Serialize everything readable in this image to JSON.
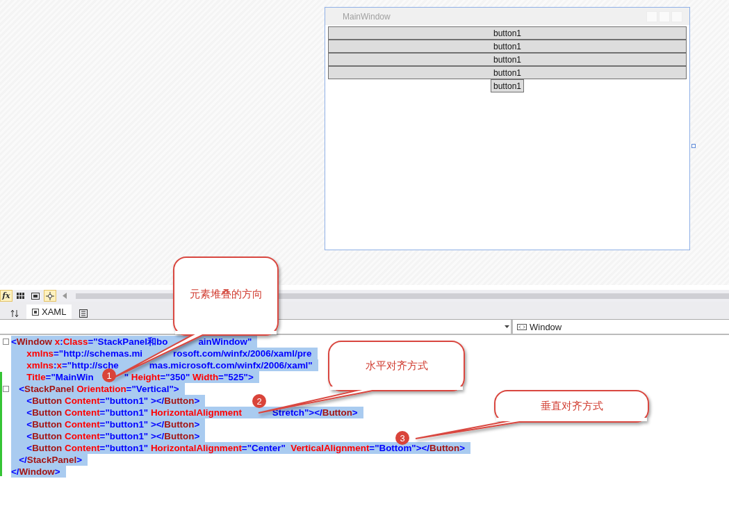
{
  "designer": {
    "window_title": "MainWindow",
    "buttons": [
      {
        "label": "button1",
        "kind": "stretch"
      },
      {
        "label": "button1",
        "kind": "stretch"
      },
      {
        "label": "button1",
        "kind": "stretch"
      },
      {
        "label": "button1",
        "kind": "stretch"
      },
      {
        "label": "button1",
        "kind": "center"
      }
    ]
  },
  "toolbar": {
    "fx": "fx",
    "tab": {
      "label": "XAML",
      "selected": true
    }
  },
  "breadcrumb": {
    "right": "Window"
  },
  "code": [
    {
      "selected": true,
      "segments": [
        {
          "kind": "bracket",
          "text": "<"
        },
        {
          "kind": "name",
          "text": "Window"
        },
        {
          "kind": "attr",
          "text": " x"
        },
        {
          "kind": "bracket",
          "text": ":"
        },
        {
          "kind": "attr",
          "text": "Class"
        },
        {
          "kind": "value",
          "text": "=\"StackPanel和bo"
        },
        {
          "kind": "gap"
        },
        {
          "kind": "value",
          "text": "ainWindow\""
        }
      ]
    },
    {
      "selected": true,
      "segments": [
        {
          "kind": "attr",
          "text": "      xmlns"
        },
        {
          "kind": "value",
          "text": "=\"http://schemas.mi"
        },
        {
          "kind": "gap"
        },
        {
          "kind": "value",
          "text": "rosoft.com/winfx/2006/xaml/pre"
        }
      ]
    },
    {
      "selected": true,
      "segments": [
        {
          "kind": "attr",
          "text": "      xmlns"
        },
        {
          "kind": "bracket",
          "text": ":"
        },
        {
          "kind": "attr",
          "text": "x"
        },
        {
          "kind": "value",
          "text": "=\"http://sche"
        },
        {
          "kind": "gap"
        },
        {
          "kind": "value",
          "text": "mas.microsoft.com/winfx/2006/xaml\""
        }
      ]
    },
    {
      "selected": true,
      "segments": [
        {
          "kind": "attr",
          "text": "      Title"
        },
        {
          "kind": "value",
          "text": "=\"MainWin"
        },
        {
          "kind": "gap"
        },
        {
          "kind": "value",
          "text": "\" "
        },
        {
          "kind": "attr",
          "text": "Height"
        },
        {
          "kind": "value",
          "text": "=\"350\" "
        },
        {
          "kind": "attr",
          "text": "Width"
        },
        {
          "kind": "value",
          "text": "=\"525\">"
        }
      ]
    },
    {
      "selected": true,
      "segments": [
        {
          "kind": "bracket",
          "text": "   <"
        },
        {
          "kind": "name",
          "text": "StackPanel"
        },
        {
          "kind": "attr",
          "text": " Orientation"
        },
        {
          "kind": "value",
          "text": "=\"Vertical\">"
        }
      ]
    },
    {
      "selected": true,
      "segments": [
        {
          "kind": "bracket",
          "text": "      <"
        },
        {
          "kind": "name",
          "text": "Button"
        },
        {
          "kind": "attr",
          "text": " Content"
        },
        {
          "kind": "value",
          "text": "=\"button1\" ></"
        },
        {
          "kind": "name",
          "text": "Button"
        },
        {
          "kind": "bracket",
          "text": ">"
        }
      ]
    },
    {
      "selected": true,
      "segments": [
        {
          "kind": "bracket",
          "text": "      <"
        },
        {
          "kind": "name",
          "text": "Button"
        },
        {
          "kind": "attr",
          "text": " Content"
        },
        {
          "kind": "value",
          "text": "=\"button1\" "
        },
        {
          "kind": "attr",
          "text": "HorizontalAlignment"
        },
        {
          "kind": "gap"
        },
        {
          "kind": "value",
          "text": "Stretch\"></"
        },
        {
          "kind": "name",
          "text": "Button"
        },
        {
          "kind": "bracket",
          "text": ">"
        }
      ]
    },
    {
      "selected": true,
      "segments": [
        {
          "kind": "bracket",
          "text": "      <"
        },
        {
          "kind": "name",
          "text": "Button"
        },
        {
          "kind": "attr",
          "text": " Content"
        },
        {
          "kind": "value",
          "text": "=\"button1\" ></"
        },
        {
          "kind": "name",
          "text": "Button"
        },
        {
          "kind": "bracket",
          "text": ">"
        }
      ]
    },
    {
      "selected": true,
      "segments": [
        {
          "kind": "bracket",
          "text": "      <"
        },
        {
          "kind": "name",
          "text": "Button"
        },
        {
          "kind": "attr",
          "text": " Content"
        },
        {
          "kind": "value",
          "text": "=\"button1\" ></"
        },
        {
          "kind": "name",
          "text": "Button"
        },
        {
          "kind": "bracket",
          "text": ">"
        }
      ]
    },
    {
      "selected": true,
      "segments": [
        {
          "kind": "bracket",
          "text": "      <"
        },
        {
          "kind": "name",
          "text": "Button"
        },
        {
          "kind": "attr",
          "text": " Content"
        },
        {
          "kind": "value",
          "text": "=\"button1\" "
        },
        {
          "kind": "attr",
          "text": "HorizontalAlignment"
        },
        {
          "kind": "value",
          "text": "=\"Center\"  "
        },
        {
          "kind": "attr",
          "text": "VerticalAlignment"
        },
        {
          "kind": "value",
          "text": "=\"Bottom\"></"
        },
        {
          "kind": "name",
          "text": "Button"
        },
        {
          "kind": "bracket",
          "text": ">"
        }
      ]
    },
    {
      "selected": true,
      "segments": [
        {
          "kind": "bracket",
          "text": "   </"
        },
        {
          "kind": "name",
          "text": "StackPanel"
        },
        {
          "kind": "bracket",
          "text": ">"
        }
      ]
    },
    {
      "selected": true,
      "segments": [
        {
          "kind": "bracket",
          "text": "</"
        },
        {
          "kind": "name",
          "text": "Window"
        },
        {
          "kind": "bracket",
          "text": ">"
        }
      ]
    }
  ],
  "callouts": [
    {
      "text": "元素堆叠的方向",
      "badge": "1"
    },
    {
      "text": "水平对齐方式",
      "badge": "2"
    },
    {
      "text": "垂直对齐方式",
      "badge": "3"
    }
  ]
}
